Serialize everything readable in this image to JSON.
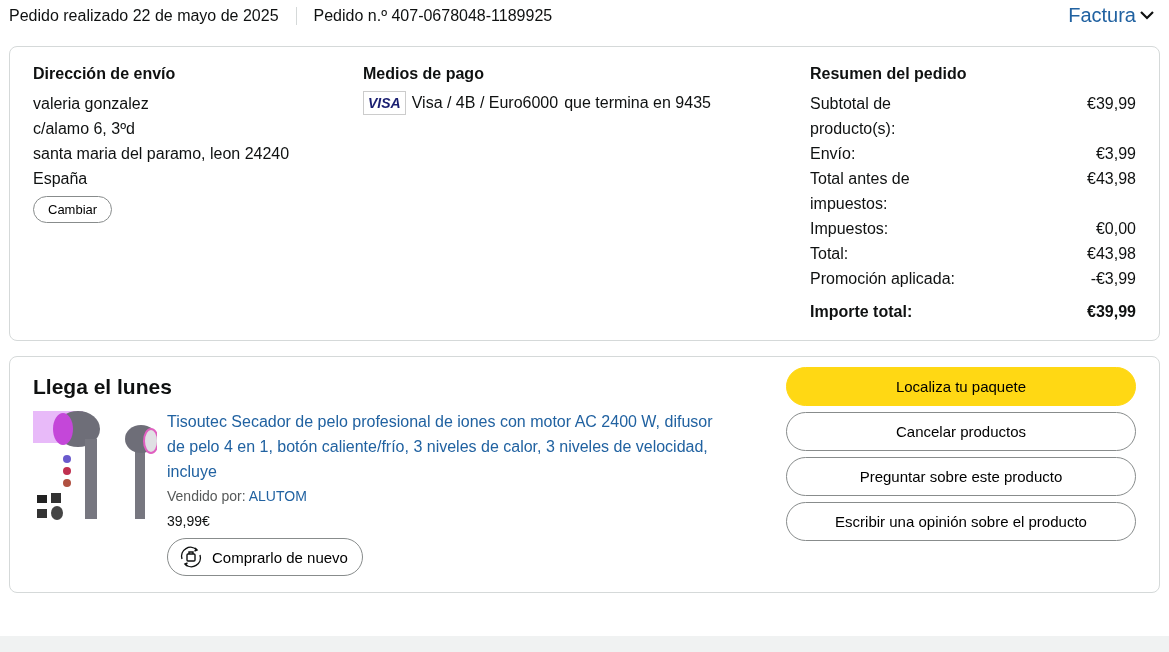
{
  "header": {
    "order_date": "Pedido realizado 22 de mayo de 2025",
    "order_number": "Pedido n.º 407-0678048-1189925",
    "invoice_link": "Factura"
  },
  "shipping": {
    "title": "Dirección de envío",
    "lines": [
      "valeria gonzalez",
      "c/alamo 6, 3ºd",
      "santa maria del paramo, leon 24240",
      "España"
    ],
    "change_button": "Cambiar"
  },
  "payment": {
    "title": "Medios de pago",
    "card_brand": "VISA",
    "card_text": "Visa / 4B / Euro6000",
    "card_suffix": "que termina en 9435"
  },
  "summary": {
    "title": "Resumen del pedido",
    "rows": [
      {
        "label": "Subtotal de producto(s):",
        "value": "€39,99",
        "bold": false
      },
      {
        "label": "Envío:",
        "value": "€3,99",
        "bold": false
      },
      {
        "label": "Total antes de impuestos:",
        "value": "€43,98",
        "bold": false
      },
      {
        "label": "Impuestos:",
        "value": "€0,00",
        "bold": false
      },
      {
        "label": "Total:",
        "value": "€43,98",
        "bold": false
      },
      {
        "label": "Promoción aplicada:",
        "value": "-€3,99",
        "bold": false
      },
      {
        "label": "Importe total:",
        "value": "€39,99",
        "bold": true
      }
    ]
  },
  "delivery": {
    "title": "Llega el lunes",
    "product": {
      "kind": "picture",
      "title": "Tisoutec Secador de pelo profesional de iones con motor AC 2400 W, difusor de pelo 4 en 1, botón caliente/frío, 3 niveles de calor, 3 niveles de velocidad, incluye",
      "sold_by_label": "Vendido por:",
      "seller": "ALUTOM",
      "price": "39,99€",
      "buy_again": "Comprarlo de nuevo"
    },
    "actions": [
      {
        "label": "Localiza tu paquete",
        "primary": true
      },
      {
        "label": "Cancelar productos",
        "primary": false
      },
      {
        "label": "Preguntar sobre este producto",
        "primary": false
      },
      {
        "label": "Escribir una opinión sobre el producto",
        "primary": false
      }
    ]
  }
}
